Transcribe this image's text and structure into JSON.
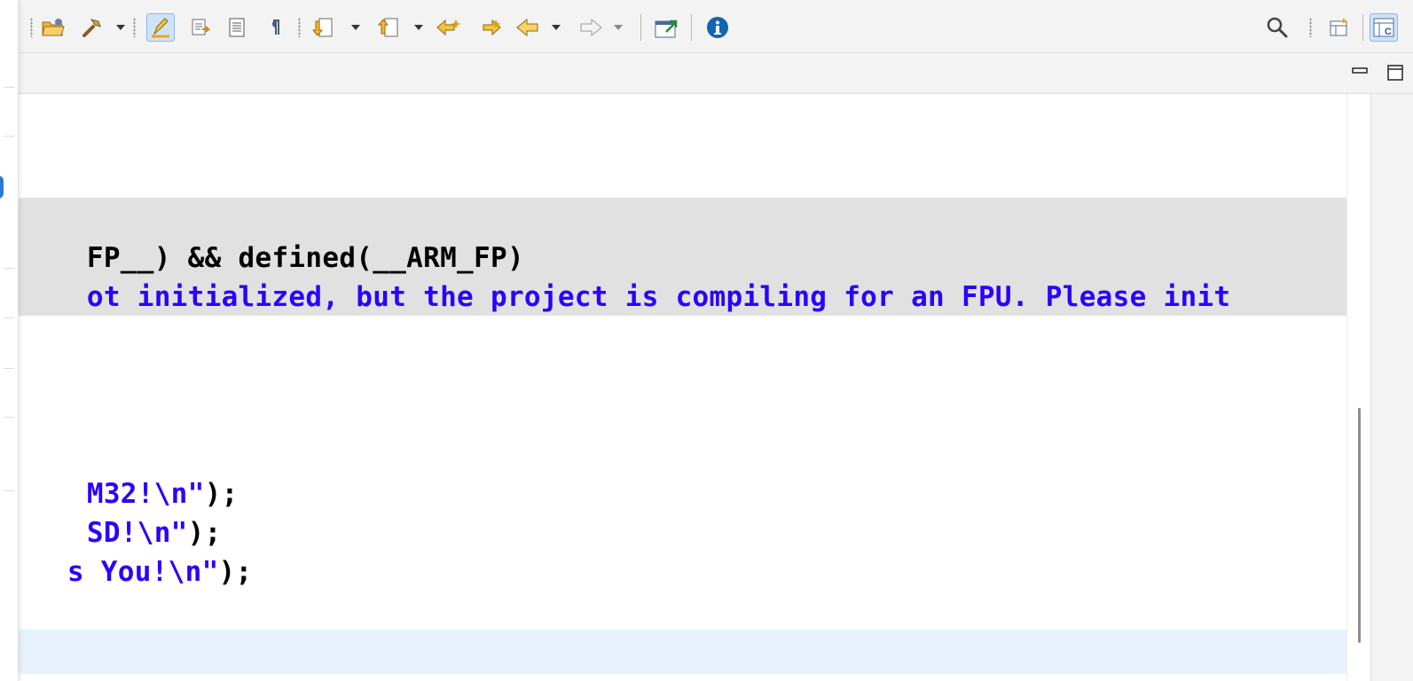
{
  "toolbar": {
    "left_icons": [
      "open-folder-icon",
      "hammer-build-icon",
      "highlight-pen-icon",
      "next-annotation-icon",
      "block-select-icon",
      "pilcrow-icon",
      "next-edit-icon",
      "previous-edit-icon",
      "last-edit-back-icon",
      "last-edit-forward-icon",
      "back-arrow-icon",
      "forward-arrow-icon",
      "external-open-icon",
      "info-icon"
    ],
    "active_icon": "highlight-pen-icon",
    "right_icons": [
      "search-icon",
      "perspective-open-icon",
      "c-perspective-icon"
    ],
    "colors": {
      "toolbar_bg": "#f3f3f3",
      "active_bg": "#cfe3f7",
      "info_blue": "#1464b4"
    }
  },
  "window_controls": {
    "minimize_icon": "minimize-icon",
    "maximize_icon": "maximize-icon"
  },
  "editor": {
    "lines": [
      {
        "id": "line-ifdef",
        "segments": [
          {
            "text": "FP__) && defined(__ARM_FP)",
            "kind": "code"
          }
        ]
      },
      {
        "id": "line-warning",
        "segments": [
          {
            "text": "ot initialized, but the project is compiling for an FPU. Please init",
            "kind": "string"
          }
        ]
      },
      {
        "id": "line-print-1",
        "segments": [
          {
            "text": "M32!\\n\"",
            "kind": "string"
          },
          {
            "text": ");",
            "kind": "code"
          }
        ]
      },
      {
        "id": "line-print-2",
        "segments": [
          {
            "text": "SD!\\n\"",
            "kind": "string"
          },
          {
            "text": ");",
            "kind": "code"
          }
        ]
      },
      {
        "id": "line-print-3",
        "segments": [
          {
            "text": "s You!\\n\"",
            "kind": "string"
          },
          {
            "text": ");",
            "kind": "code"
          }
        ]
      }
    ],
    "colors": {
      "code": "#000000",
      "string": "#2a00ff",
      "inactive_block_bg": "#e1e1e1",
      "current_line_bg": "#e8f2fe"
    }
  }
}
